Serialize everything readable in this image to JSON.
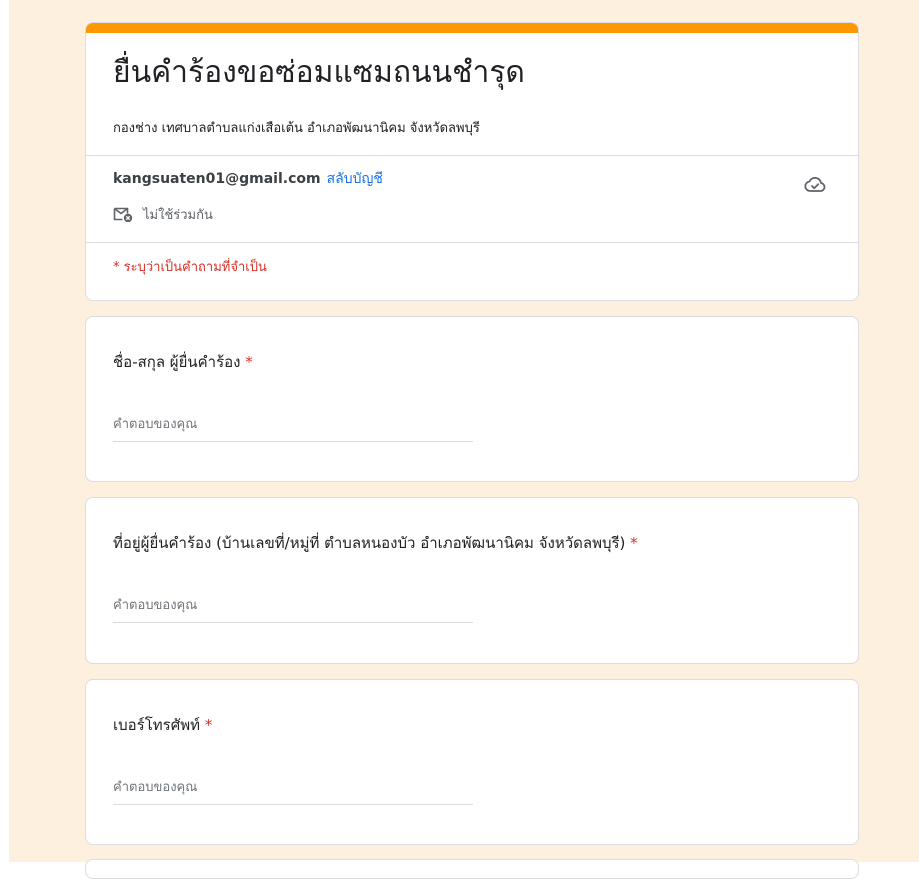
{
  "form": {
    "title": "ยื่นคำร้องขอซ่อมแซมถนนชำรุด",
    "description": "กองช่าง เทศบาลตำบลแก่งเสือเต้น อำเภอพัฒนานิคม จังหวัดลพบุรี",
    "accent_color": "#ff9800",
    "background_color": "#fdf0df"
  },
  "account": {
    "email": "kangsuaten01@gmail.com",
    "switch_label": "สลับบัญชี",
    "not_shared_label": "ไม่ใช้ร่วมกัน",
    "save_status_icon": "cloud-check-icon"
  },
  "required_note": "* ระบุว่าเป็นคำถามที่จำเป็น",
  "questions": [
    {
      "label": "ชื่อ-สกุล ผู้ยื่นคำร้อง",
      "required_mark": "*",
      "placeholder": "คำตอบของคุณ",
      "value": ""
    },
    {
      "label": "ที่อยู่ผู้ยื่นคำร้อง (บ้านเลขที่/หมู่ที่ ตำบลหนองบัว อำเภอพัฒนานิคม จังหวัดลพบุรี)",
      "required_mark": "*",
      "placeholder": "คำตอบของคุณ",
      "value": ""
    },
    {
      "label": "เบอร์โทรศัพท์",
      "required_mark": "*",
      "placeholder": "คำตอบของคุณ",
      "value": ""
    }
  ]
}
